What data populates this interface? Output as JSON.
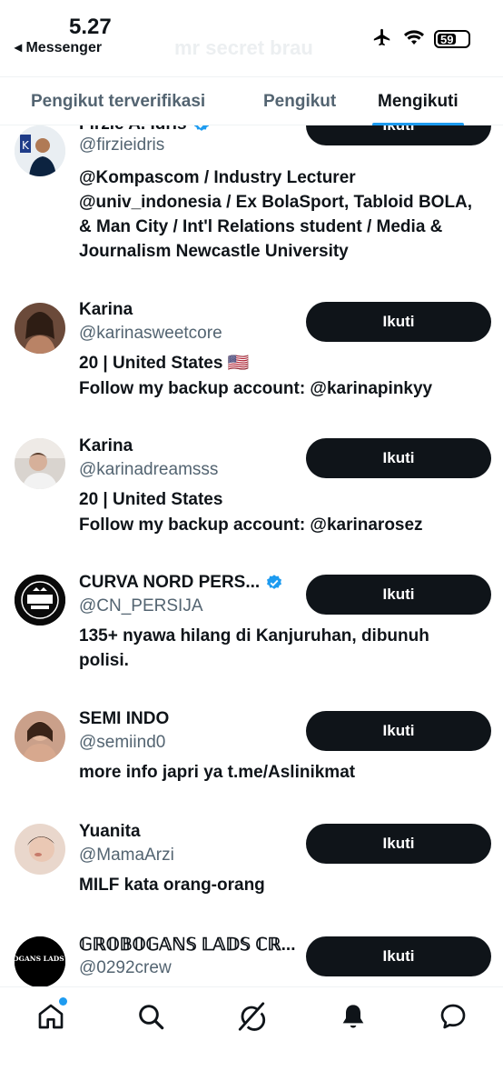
{
  "status_bar": {
    "time": "5.27",
    "back_label": "◂ Messenger",
    "battery": "59",
    "ghost_title": "mr secret brau"
  },
  "tabs": [
    {
      "label": "Pengikut terverifikasi",
      "active": false
    },
    {
      "label": "Pengikut",
      "active": false
    },
    {
      "label": "Mengikuti",
      "active": true
    }
  ],
  "accent_color": "#1d9bf0",
  "follow_label": "Ikuti",
  "users": [
    {
      "name": "Firzie A. Idris",
      "verified": true,
      "handle": "@firzieidris",
      "bio": "@Kompascom / Industry Lecturer @univ_indonesia / Ex BolaSport, Tabloid BOLA, & Man City / Int'l Relations student / Media & Journalism Newcastle University"
    },
    {
      "name": "Karina",
      "verified": false,
      "handle": "@karinasweetcore",
      "bio_line1": "20 | United States 🇺🇸",
      "bio_line2": "Follow my backup account: @karinapinkyy"
    },
    {
      "name": "Karina",
      "verified": false,
      "handle": "@karinadreamsss",
      "bio_line1": "20 | United States",
      "bio_line2": "Follow my backup account: @karinarosez"
    },
    {
      "name": "CURVA NORD PERS...",
      "verified": true,
      "handle": "@CN_PERSIJA",
      "bio": "135+ nyawa hilang di Kanjuruhan, dibunuh polisi."
    },
    {
      "name": "SEMI INDO",
      "verified": false,
      "handle": "@semiind0",
      "bio": "more info japri ya t.me/Aslinikmat"
    },
    {
      "name": "Yuanita",
      "verified": false,
      "handle": "@MamaArzi",
      "bio": "MILF kata orang-orang"
    },
    {
      "name": "𝔾ℝ𝕆𝔹𝕆𝔾𝔸ℕ𝕊 𝕃𝔸𝔻𝕊 ℂℝ...",
      "verified": false,
      "handle": "@0292crew",
      "avatar_text": "GROBOGANS LADS CREW"
    }
  ],
  "bottom_nav": [
    {
      "icon": "home-icon",
      "has_dot": true
    },
    {
      "icon": "search-icon",
      "has_dot": false
    },
    {
      "icon": "grok-icon",
      "has_dot": false
    },
    {
      "icon": "bell-icon",
      "has_dot": false
    },
    {
      "icon": "messages-icon",
      "has_dot": false
    }
  ]
}
